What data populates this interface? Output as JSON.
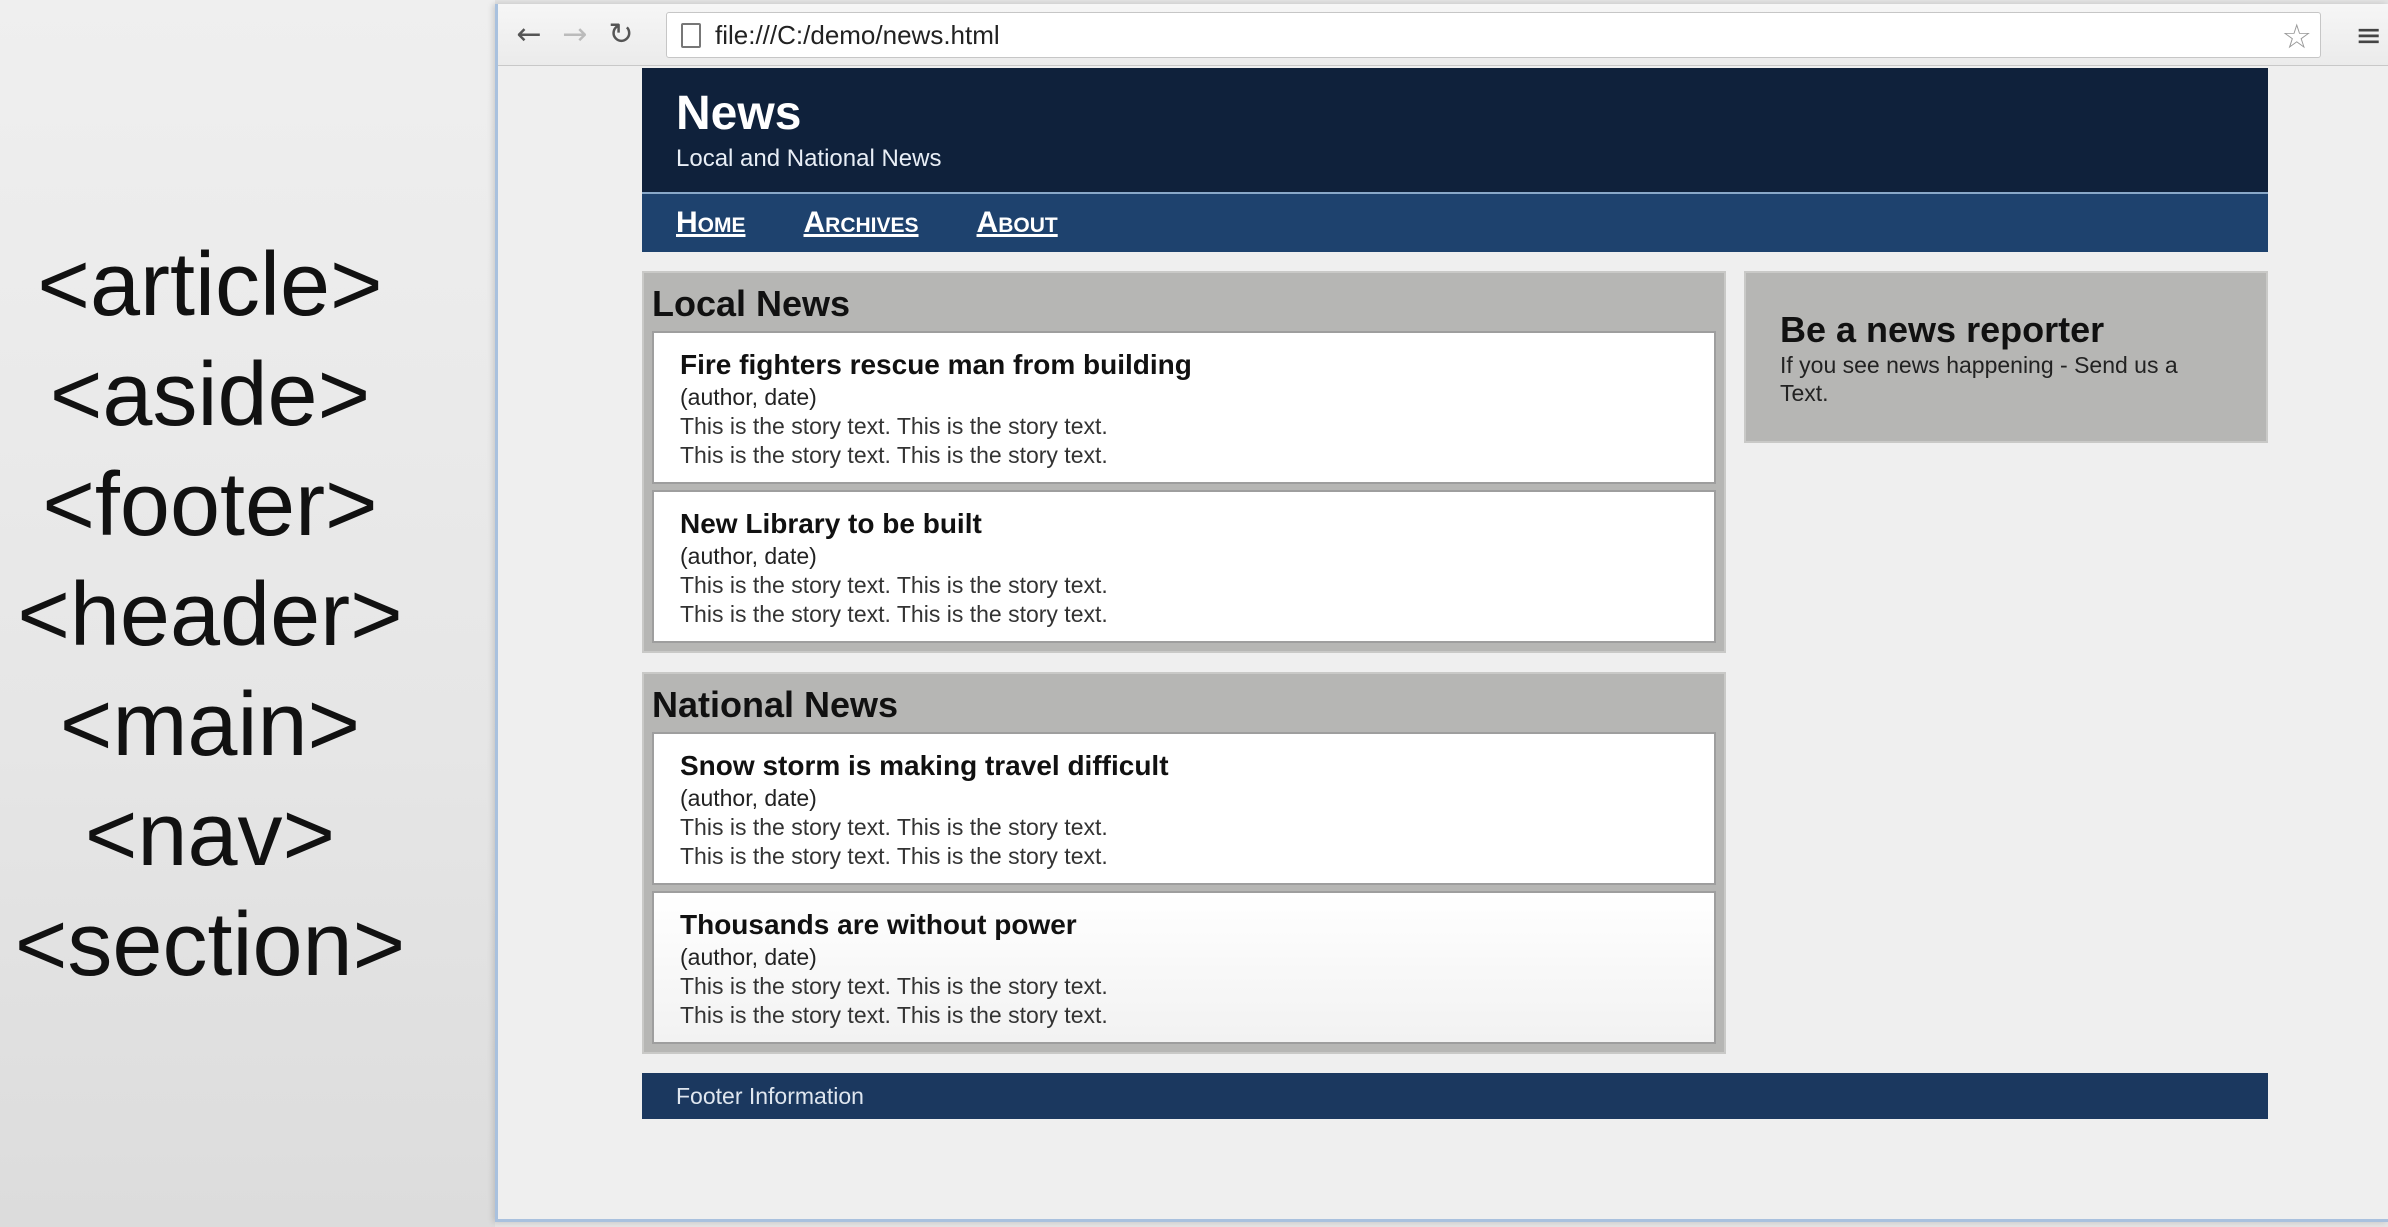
{
  "slide": {
    "tags": [
      "<article>",
      "<aside>",
      "<footer>",
      "<header>",
      "<main>",
      "<nav>",
      "<section>"
    ]
  },
  "browser": {
    "back_icon": "back-arrow-icon",
    "forward_icon": "forward-arrow-icon",
    "reload_icon": "reload-icon",
    "url": "file:///C:/demo/news.html",
    "star_icon": "bookmark-star-icon",
    "menu_icon": "hamburger-menu-icon"
  },
  "site": {
    "title": "News",
    "subtitle": "Local and National News",
    "nav": [
      "Home",
      "Archives",
      "About"
    ],
    "footer": "Footer Information",
    "colors": {
      "header_bg": "#0f213b",
      "nav_bg": "#1e426e",
      "footer_bg": "#1b385f",
      "section_bg": "#b6b6b4"
    }
  },
  "sections": [
    {
      "heading": "Local News",
      "articles": [
        {
          "title": "Fire fighters rescue man from building",
          "byline": "(author, date)",
          "line1": "This is the story text. This is the story text.",
          "line2": "This is the story text. This is the story text."
        },
        {
          "title": "New Library to be built",
          "byline": "(author, date)",
          "line1": "This is the story text. This is the story text.",
          "line2": "This is the story text. This is the story text."
        }
      ]
    },
    {
      "heading": "National News",
      "articles": [
        {
          "title": "Snow storm is making travel difficult",
          "byline": "(author, date)",
          "line1": "This is the story text. This is the story text.",
          "line2": "This is the story text. This is the story text."
        },
        {
          "title": "Thousands are without power",
          "byline": "(author, date)",
          "line1": "This is the story text. This is the story text.",
          "line2": "This is the story text. This is the story text."
        }
      ]
    }
  ],
  "aside": {
    "title": "Be a news reporter",
    "text": "If you see news happening - Send us a Text."
  }
}
